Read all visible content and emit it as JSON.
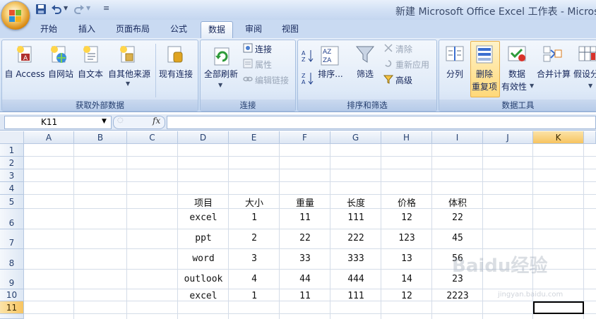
{
  "window": {
    "title": "新建 Microsoft Office Excel 工作表 - Microsoft"
  },
  "quick_access": {
    "icons": [
      "save-icon",
      "undo-icon",
      "redo-icon",
      "customize-icon"
    ]
  },
  "tabs": [
    {
      "label": "开始",
      "active": false
    },
    {
      "label": "插入",
      "active": false
    },
    {
      "label": "页面布局",
      "active": false
    },
    {
      "label": "公式",
      "active": false
    },
    {
      "label": "数据",
      "active": true
    },
    {
      "label": "审阅",
      "active": false
    },
    {
      "label": "视图",
      "active": false
    }
  ],
  "ribbon": {
    "external_data": {
      "label": "获取外部数据",
      "access": "自 Access",
      "web": "自网站",
      "text": "自文本",
      "other": "自其他来源",
      "existing": "现有连接"
    },
    "connections": {
      "label": "连接",
      "refresh_all": "全部刷新",
      "connect": "连接",
      "properties": "属性",
      "edit_links": "编辑链接"
    },
    "sort_filter": {
      "label": "排序和筛选",
      "sort": "排序...",
      "filter": "筛选",
      "clear": "清除",
      "reapply": "重新应用",
      "advanced": "高级"
    },
    "data_tools": {
      "label": "数据工具",
      "split": "分列",
      "remove_dup_1": "删除",
      "remove_dup_2": "重复项",
      "validation_1": "数据",
      "validation_2": "有效性",
      "consolidate": "合并计算",
      "whatif": "假设分"
    }
  },
  "formula_bar": {
    "name_box": "K11",
    "fx": "fx",
    "value": ""
  },
  "sheet": {
    "columns": [
      "A",
      "B",
      "C",
      "D",
      "E",
      "F",
      "G",
      "H",
      "I",
      "J",
      "K"
    ],
    "rows": [
      "1",
      "2",
      "3",
      "4",
      "5",
      "6",
      "7",
      "8",
      "9",
      "10",
      "11"
    ],
    "selected_column": "K",
    "selected_row": "11",
    "table": {
      "headers": [
        "项目",
        "大小",
        "重量",
        "长度",
        "价格",
        "体积"
      ],
      "rows": [
        [
          "excel",
          "1",
          "11",
          "111",
          "12",
          "22"
        ],
        [
          "ppt",
          "2",
          "22",
          "222",
          "123",
          "45"
        ],
        [
          "word",
          "3",
          "33",
          "333",
          "13",
          "56"
        ],
        [
          "outlook",
          "4",
          "44",
          "444",
          "14",
          "23"
        ],
        [
          "excel",
          "1",
          "11",
          "111",
          "12",
          "2223"
        ]
      ]
    }
  },
  "watermark": {
    "main": "Baidu经验",
    "sub": "jingyan.baidu.com"
  }
}
